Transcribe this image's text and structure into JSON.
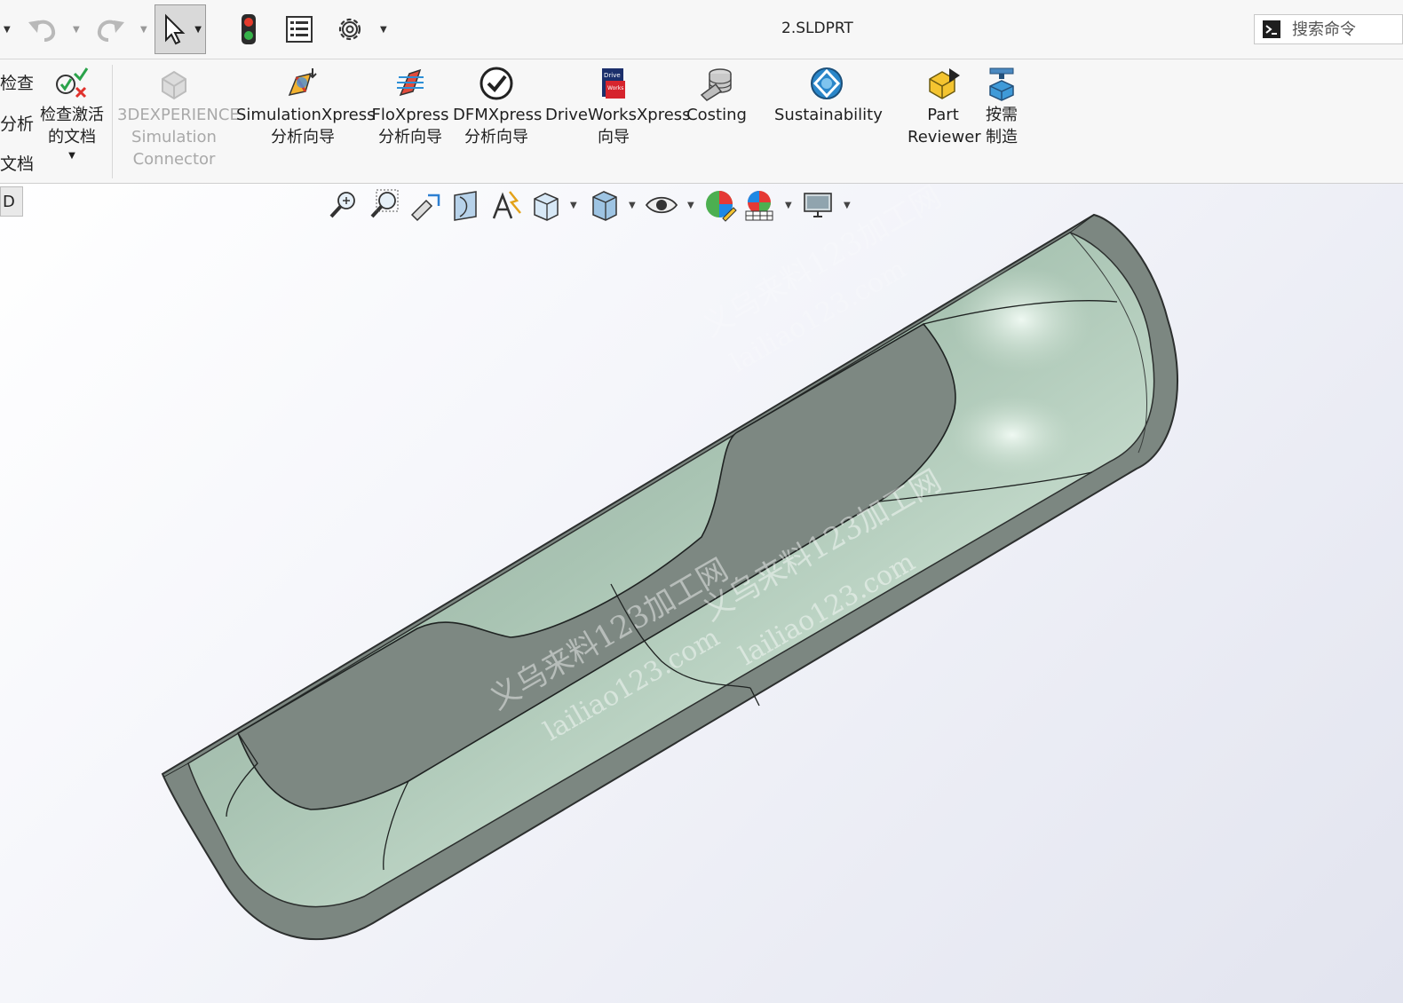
{
  "window": {
    "title": "2.SLDPRT"
  },
  "search": {
    "placeholder": "搜索命令"
  },
  "ribbon": {
    "left_cut_labels": [
      "检查",
      "分析",
      "文档"
    ],
    "check_active_doc": "检查激活\n的文档",
    "items": [
      {
        "id": "3dexperience",
        "label": "3DEXPERIENCE\nSimulation\nConnector",
        "enabled": false,
        "icon": "3dexperience-icon"
      },
      {
        "id": "simulationxpress",
        "label": "SimulationXpress\n分析向导",
        "enabled": true,
        "icon": "simulationxpress-icon"
      },
      {
        "id": "floxpress",
        "label": "FloXpress\n分析向导",
        "enabled": true,
        "icon": "floxpress-icon"
      },
      {
        "id": "dfmxpress",
        "label": "DFMXpress\n分析向导",
        "enabled": true,
        "icon": "dfmxpress-icon"
      },
      {
        "id": "driveworksxpress",
        "label": "DriveWorksXpress\n向导",
        "enabled": true,
        "icon": "driveworks-icon"
      },
      {
        "id": "costing",
        "label": "Costing",
        "enabled": true,
        "icon": "costing-icon"
      },
      {
        "id": "sustainability",
        "label": "Sustainability",
        "enabled": true,
        "icon": "sustainability-icon"
      },
      {
        "id": "part-reviewer",
        "label": "Part\nReviewer",
        "enabled": true,
        "icon": "part-reviewer-icon"
      },
      {
        "id": "make-on-demand",
        "label": "按需\n制造",
        "enabled": true,
        "icon": "3d-print-icon"
      }
    ]
  },
  "viewport": {
    "tab_label": "D",
    "watermark": {
      "cn": "义乌来料123加工网",
      "url": "lailiao123.com"
    }
  },
  "colors": {
    "model_dark": "#7d8882",
    "model_light": "#b8d3c2",
    "ribbon_bg": "#f7f7f7"
  }
}
